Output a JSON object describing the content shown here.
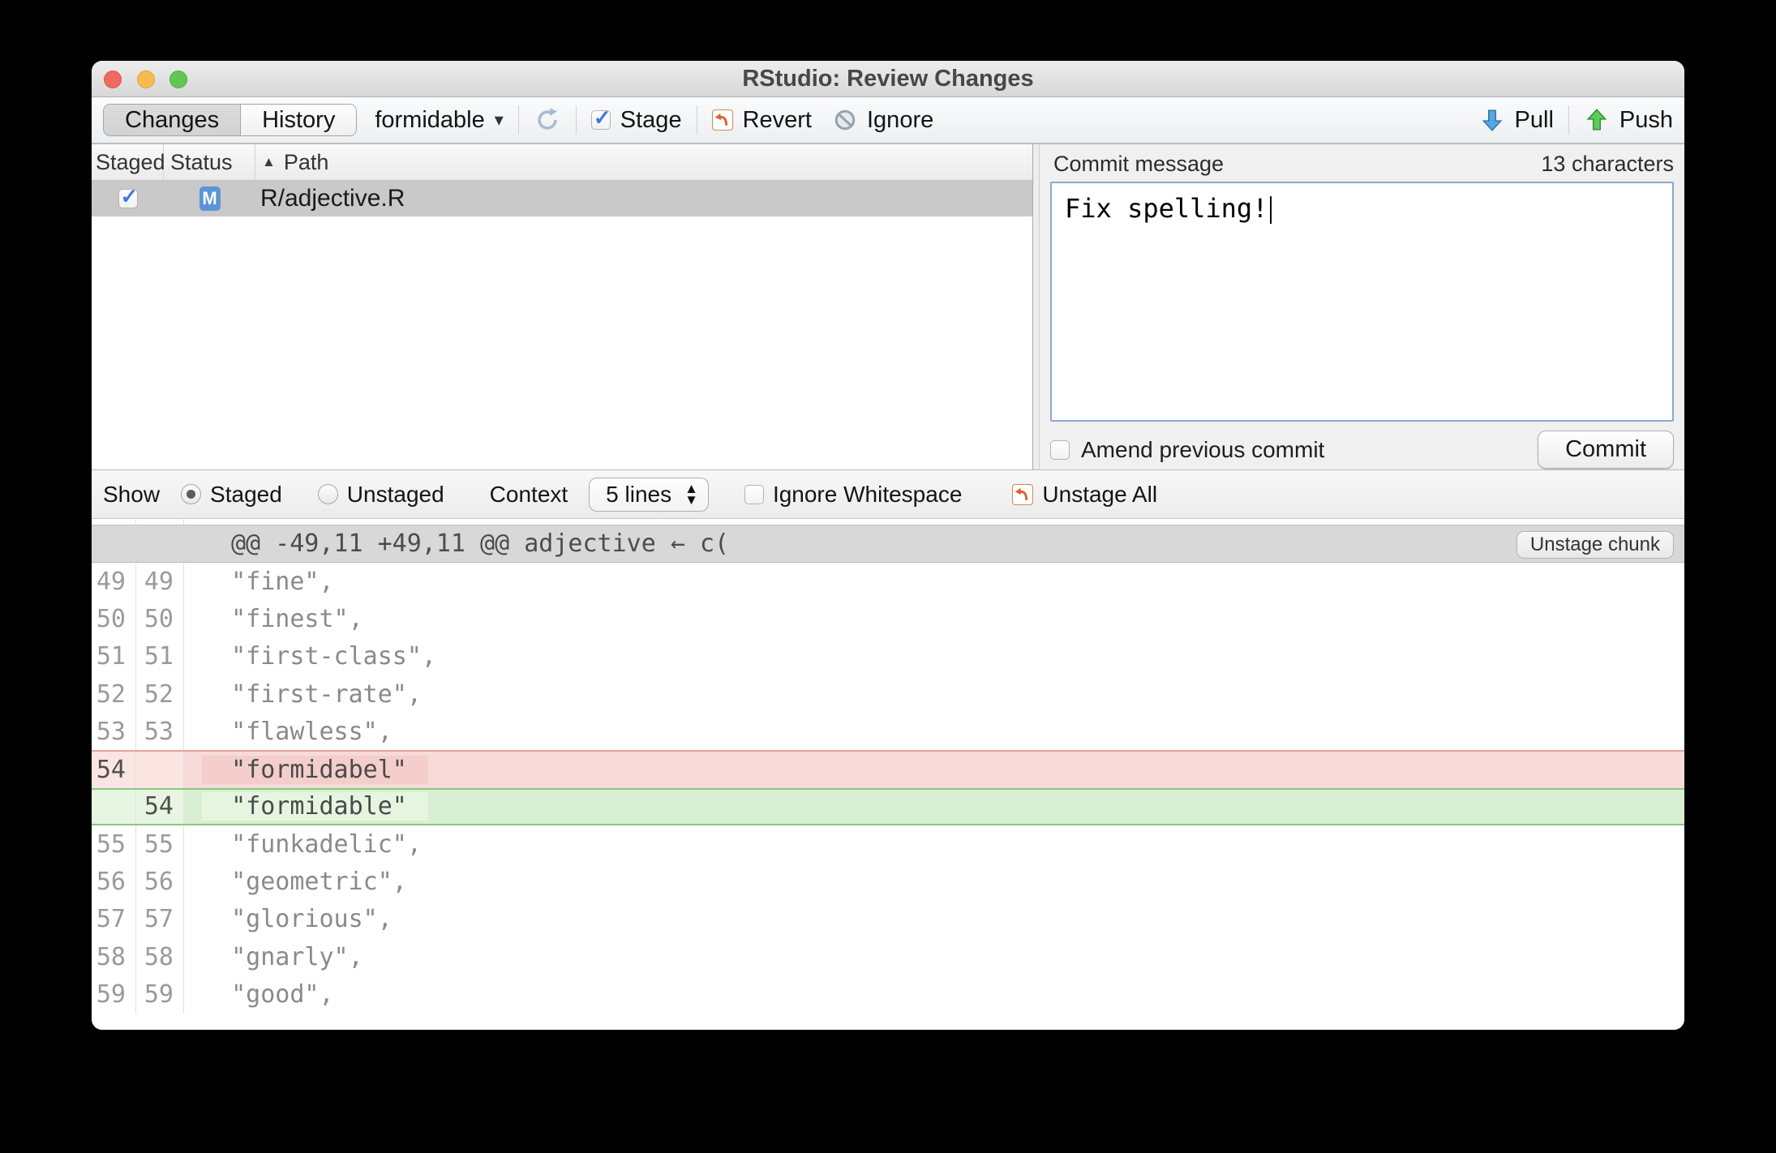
{
  "window": {
    "title": "RStudio: Review Changes"
  },
  "icons": {
    "check": "✓",
    "caret_down": "▾",
    "sort_asc": "▲",
    "stepper_up": "▲",
    "stepper_down": "▼"
  },
  "toolbar": {
    "changes_tab": "Changes",
    "history_tab": "History",
    "branch": "formidable",
    "stage_label": "Stage",
    "revert_label": "Revert",
    "ignore_label": "Ignore",
    "pull_label": "Pull",
    "push_label": "Push"
  },
  "file_table": {
    "columns": [
      "Staged",
      "Status",
      "Path"
    ],
    "rows": [
      {
        "staged": true,
        "status": "M",
        "path": "R/adjective.R"
      }
    ]
  },
  "commit": {
    "label": "Commit message",
    "char_count": "13 characters",
    "message": "Fix spelling!",
    "amend_label": "Amend previous commit",
    "button": "Commit"
  },
  "diff_controls": {
    "show_label": "Show",
    "staged": "Staged",
    "unstaged": "Unstaged",
    "selected_filter": "Staged",
    "context_label": "Context",
    "context_value": "5 lines",
    "ignore_whitespace": "Ignore Whitespace",
    "unstage_all": "Unstage All"
  },
  "diff": {
    "chunk_header": "@@ -49,11 +49,11 @@ adjective ← c(",
    "unstage_chunk": "Unstage chunk",
    "lines": [
      {
        "old": "49",
        "new": "49",
        "type": "context",
        "text": "  \"fine\","
      },
      {
        "old": "50",
        "new": "50",
        "type": "context",
        "text": "  \"finest\","
      },
      {
        "old": "51",
        "new": "51",
        "type": "context",
        "text": "  \"first-class\","
      },
      {
        "old": "52",
        "new": "52",
        "type": "context",
        "text": "  \"first-rate\","
      },
      {
        "old": "53",
        "new": "53",
        "type": "context",
        "text": "  \"flawless\","
      },
      {
        "old": "54",
        "new": "",
        "type": "removed",
        "text": "  \"formidabel\""
      },
      {
        "old": "",
        "new": "54",
        "type": "added",
        "text": "  \"formidable\""
      },
      {
        "old": "55",
        "new": "55",
        "type": "context",
        "text": "  \"funkadelic\","
      },
      {
        "old": "56",
        "new": "56",
        "type": "context",
        "text": "  \"geometric\","
      },
      {
        "old": "57",
        "new": "57",
        "type": "context",
        "text": "  \"glorious\","
      },
      {
        "old": "58",
        "new": "58",
        "type": "context",
        "text": "  \"gnarly\","
      },
      {
        "old": "59",
        "new": "59",
        "type": "context",
        "text": "  \"good\","
      }
    ]
  },
  "colors": {
    "accent_check_blue": "#3b76e3",
    "status_badge_blue": "#5c95d6",
    "pull_arrow_blue": "#58a7dc",
    "push_arrow_green": "#5ec95f",
    "revert_orange": "#e05f2a",
    "removed_row_bg": "#f8dbd8",
    "added_row_bg": "#d9efd3",
    "selected_file_row": "#c9c9c9"
  }
}
